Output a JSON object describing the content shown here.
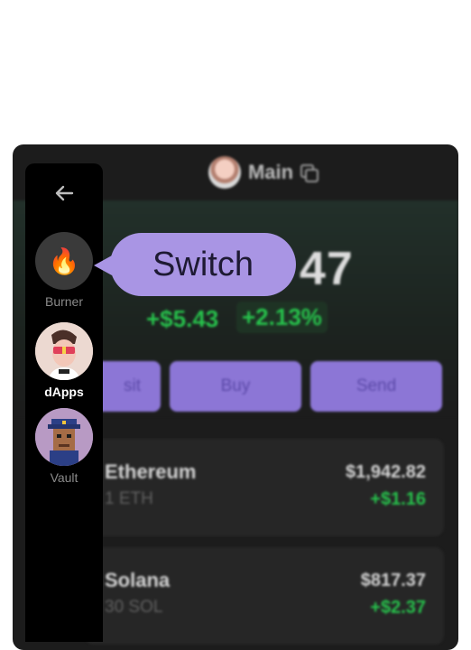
{
  "header": {
    "title": "Main",
    "avatar_icon": "user-avatar-icon",
    "copy_icon": "copy-icon"
  },
  "balance": {
    "display": "47",
    "change_usd": "+$5.43",
    "change_pct": "+2.13%"
  },
  "actions": {
    "deposit_partial": "sit",
    "buy": "Buy",
    "send": "Send"
  },
  "tokens": [
    {
      "name": "Ethereum",
      "amount": "1 ETH",
      "value": "$1,942.82",
      "change": "+$1.16"
    },
    {
      "name": "Solana",
      "amount": "30 SOL",
      "value": "$817.37",
      "change": "+$2.37"
    }
  ],
  "sidebar": {
    "back_icon": "arrow-left-icon",
    "accounts": [
      {
        "label": "Burner",
        "icon": "fire-emoji",
        "emoji": "🔥"
      },
      {
        "label": "dApps",
        "icon": "nft-avatar-icon"
      },
      {
        "label": "Vault",
        "icon": "pixel-punk-avatar-icon"
      }
    ]
  },
  "tooltip": {
    "text": "Switch"
  },
  "colors": {
    "accent": "#8c76d6",
    "tooltip": "#a995e4",
    "positive": "#27c24c",
    "panel": "#1c1c1c",
    "sidebar": "#000000"
  }
}
